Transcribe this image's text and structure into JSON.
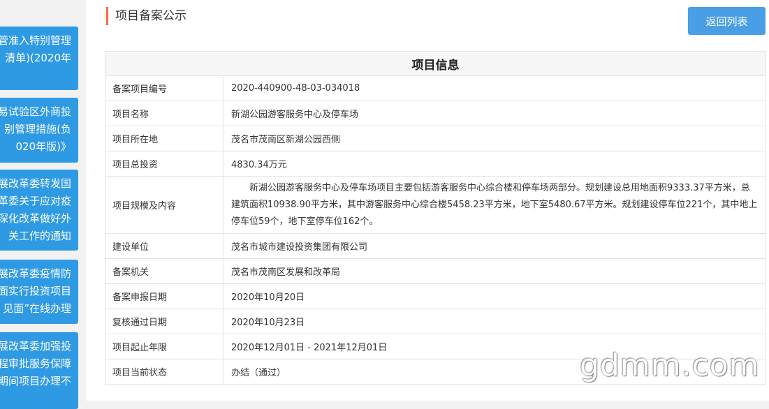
{
  "sidebar": {
    "items": [
      {
        "line1": "管准入特别管理",
        "line2": "清单)(2020年"
      },
      {
        "line1": "易试验区外商投",
        "line2": "别管理措施(负",
        "line3": "020年版)》"
      },
      {
        "line1": "展改革委转发国",
        "line2": "革委关于应对疫",
        "line3": "深化改革做好外",
        "line4": "关工作的通知"
      },
      {
        "line1": "展改革委疫情防",
        "line2": "面实行投资项目",
        "line3": "见面”在线办理"
      },
      {
        "line1": "展改革委加强投",
        "line2": "程审批服务保障",
        "line3": "期间项目办理不"
      }
    ]
  },
  "header": {
    "title": "项目备案公示",
    "back_label": "返回列表"
  },
  "table": {
    "caption": "项目信息",
    "rows": [
      {
        "label": "备案项目编号",
        "value": "2020-440900-48-03-034018"
      },
      {
        "label": "项目名称",
        "value": "新湖公园游客服务中心及停车场"
      },
      {
        "label": "项目所在地",
        "value": "茂名市茂南区新湖公园西侧"
      },
      {
        "label": "项目总投资",
        "value": "4830.34万元"
      },
      {
        "label": "项目规模及内容",
        "value": "新湖公园游客服务中心及停车场项目主要包括游客服务中心综合楼和停车场两部分。规划建设总用地面积9333.37平方米，总建筑面积10938.90平方米，其中游客服务中心综合楼5458.23平方米，地下室5480.67平方米。规划建设停车位221个，其中地上停车位59个，地下室停车位162个。"
      },
      {
        "label": "建设单位",
        "value": "茂名市城市建设投资集团有限公司"
      },
      {
        "label": "备案机关",
        "value": "茂名市茂南区发展和改革局"
      },
      {
        "label": "备案申报日期",
        "value": "2020年10月20日"
      },
      {
        "label": "复核通过日期",
        "value": "2020年10月23日"
      },
      {
        "label": "项目起止年限",
        "value": "2020年12月01日 - 2021年12月01日"
      },
      {
        "label": "项目当前状态",
        "value": "办结（通过）"
      }
    ]
  },
  "watermark": "gdmm.com"
}
